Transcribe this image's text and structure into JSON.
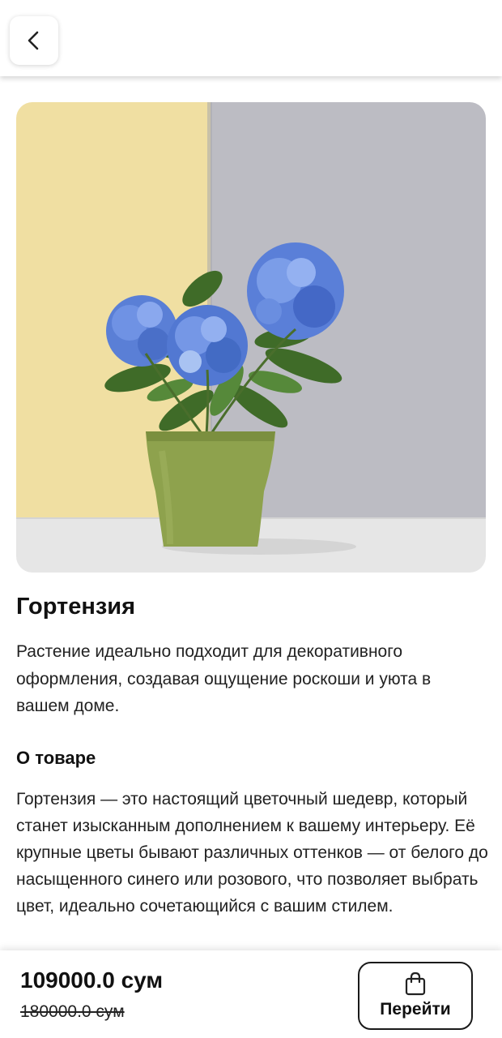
{
  "header": {
    "back_icon": "chevron-left-icon"
  },
  "product": {
    "image_alt": "hydrangea-plant-in-green-pot",
    "title": "Гортензия",
    "description": "Растение идеально подходит для декоративного оформления, создавая ощущение роскоши и уюта в вашем доме.",
    "about_heading": "О товаре",
    "about_text": "Гортензия — это настоящий цветочный шедевр, который станет изысканным дополнением к вашему интерьеру. Её крупные цветы бывают различных оттенков — от белого до насыщенного синего или розового, что позволяет выбрать цвет, идеально сочетающийся с вашим стилем."
  },
  "footer": {
    "price": "109000.0 сум",
    "old_price": "180000.0 сум",
    "go_button_label": "Перейти",
    "go_button_icon": "shopping-bag-icon"
  },
  "colors": {
    "text": "#111111",
    "background": "#ffffff",
    "border": "#1a1a1a"
  }
}
